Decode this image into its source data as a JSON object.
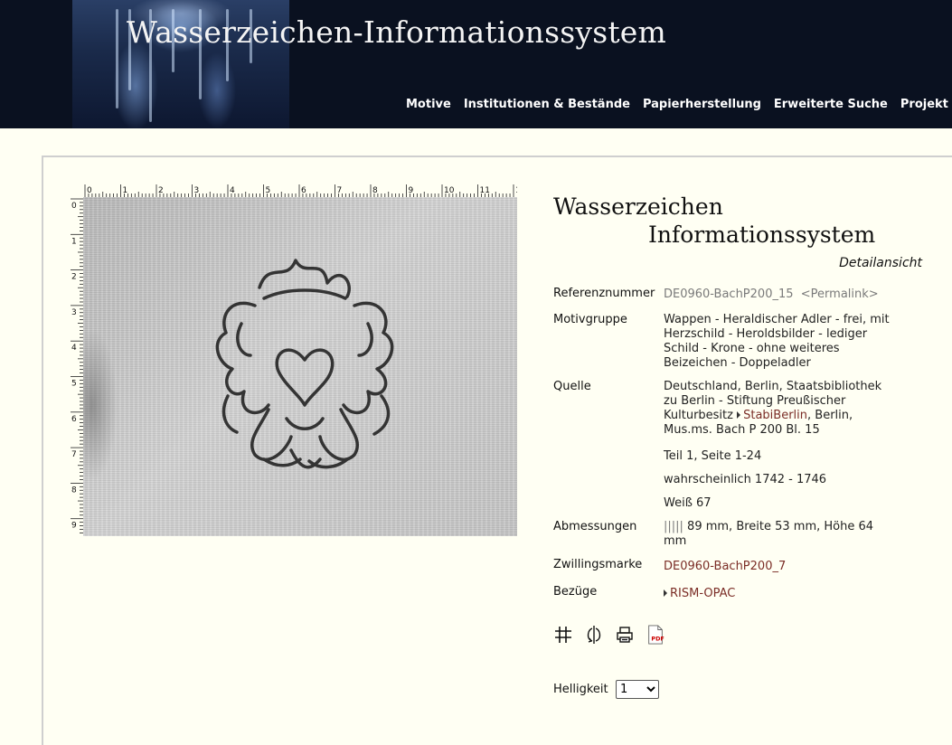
{
  "header": {
    "title": "Wasserzeichen-Informationssystem",
    "nav": [
      "Motive",
      "Institutionen & Bestände",
      "Papierherstellung",
      "Erweiterte Suche",
      "Projekt"
    ]
  },
  "logo": {
    "line1": "Wasserzeichen",
    "line2": "Informationssystem",
    "subtitle": "Detailansicht"
  },
  "ruler": {
    "top_labels": [
      "0",
      "1",
      "2",
      "3",
      "4",
      "5",
      "6",
      "7",
      "8",
      "9",
      "10",
      "11",
      "1"
    ],
    "left_labels": [
      "0",
      "1",
      "2",
      "3",
      "4",
      "5",
      "6",
      "7",
      "8",
      "9"
    ]
  },
  "details": {
    "reference": {
      "label": "Referenznummer",
      "value": "DE0960-BachP200_15",
      "permalink": "<Permalink>"
    },
    "motif": {
      "label": "Motivgruppe",
      "value": "Wappen - Heraldischer Adler - frei, mit Herzschild - Heroldsbilder - lediger Schild - Krone - ohne weiteres Beizeichen - Doppeladler"
    },
    "source": {
      "label": "Quelle",
      "text1": "Deutschland, Berlin, Staatsbibliothek zu Berlin - Stiftung Preußischer Kulturbesitz",
      "link": "StabiBerlin",
      "text2": ", Berlin, Mus.ms. Bach P 200 Bl. 15",
      "part": "Teil 1, Seite 1-24",
      "date": "wahrscheinlich 1742 - 1746",
      "weiss": "Weiß 67"
    },
    "dimensions": {
      "label": "Abmessungen",
      "bars": "|||||",
      "value": "89 mm, Breite 53 mm, Höhe 64 mm"
    },
    "twin": {
      "label": "Zwillingsmarke",
      "value": "DE0960-BachP200_7"
    },
    "refs": {
      "label": "Bezüge",
      "value": "RISM-OPAC"
    }
  },
  "tools": [
    "grid-icon",
    "mirror-icon",
    "print-icon",
    "pdf-icon"
  ],
  "pdf_text": "PDF",
  "brightness": {
    "label": "Helligkeit",
    "selected": "1"
  }
}
